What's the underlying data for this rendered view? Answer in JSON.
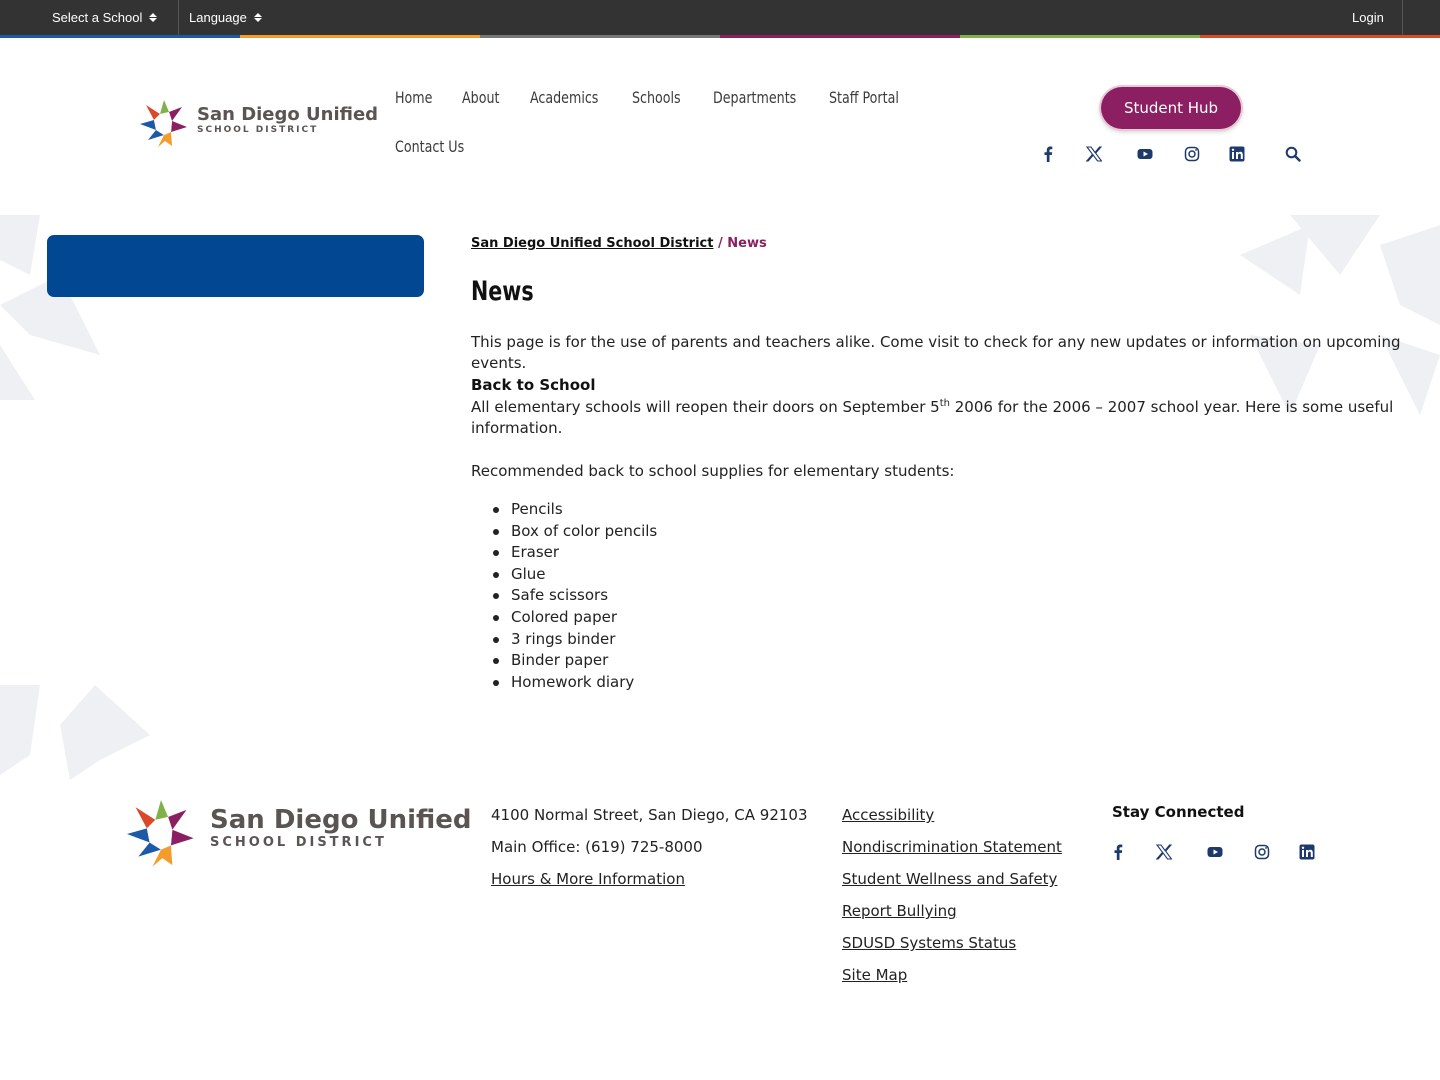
{
  "topbar": {
    "select_school": "Select a School",
    "language": "Language",
    "login": "Login"
  },
  "brand_colors": [
    "#1c5aa8",
    "#f39c2b",
    "#777777",
    "#8b1f62",
    "#7fb24b",
    "#d84a2a"
  ],
  "header": {
    "logo_line1": "San Diego Unified",
    "logo_line2": "SCHOOL DISTRICT",
    "nav": [
      "Home",
      "About",
      "Academics",
      "Schools",
      "Departments",
      "Staff Portal",
      "Contact Us"
    ],
    "student_hub": "Student Hub",
    "social": [
      "facebook-icon",
      "x-icon",
      "youtube-icon",
      "instagram-icon",
      "linkedin-icon"
    ],
    "search_icon": "search-icon",
    "accent": "#8b1f62",
    "sidebar_block_color": "#024791"
  },
  "main": {
    "breadcrumb": {
      "home": "San Diego Unified School District",
      "separator": "/",
      "current": "News"
    },
    "title": "News",
    "intro": "This page is for the use of parents and teachers alike. Come visit to check for any new updates or information on upcoming events.",
    "section_heading": "Back to School",
    "section_text_pre": "All elementary schools will reopen their doors on September 5",
    "section_text_sup": "th",
    "section_text_post1": " 2006 for the 2006 – 2007 school year. Here is some useful",
    "section_text_post2": "information.",
    "supplies_intro": "Recommended back to school supplies for elementary students:",
    "supplies": [
      "Pencils",
      "Box of color pencils",
      "Eraser",
      "Glue",
      "Safe scissors",
      "Colored paper",
      "3 rings binder",
      "Binder paper",
      "Homework diary"
    ]
  },
  "footer": {
    "logo_line1": "San Diego Unified",
    "logo_line2": "SCHOOL DISTRICT",
    "address": "4100 Normal Street, San Diego, CA 92103",
    "phone": "Main Office: (619) 725-8000",
    "hours_link": "Hours & More Information",
    "links": [
      "Accessibility",
      "Nondiscrimination Statement",
      "Student Wellness and Safety",
      "Report Bullying",
      "SDUSD Systems Status",
      "Site Map"
    ],
    "stay_connected": "Stay Connected"
  }
}
